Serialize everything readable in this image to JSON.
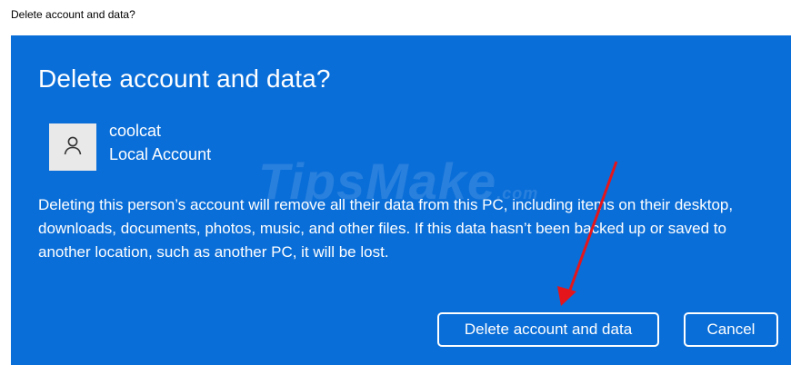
{
  "window": {
    "title": "Delete account and data?"
  },
  "dialog": {
    "title": "Delete account and data?",
    "account": {
      "name": "coolcat",
      "type": "Local Account",
      "avatar_icon": "person-icon"
    },
    "message": "Deleting this person’s account will remove all their data from this PC, including items on their desktop, downloads, documents, photos, music, and other files. If this data hasn’t been backed up or saved to another location, such as another PC, it will be lost.",
    "buttons": {
      "primary_label": "Delete account and data",
      "secondary_label": "Cancel"
    }
  },
  "watermark": {
    "text": "TipsMake",
    "suffix": ".com"
  },
  "annotation": {
    "arrow_color": "#e4161b"
  },
  "colors": {
    "dialog_background": "#0a6ed8",
    "text": "#ffffff",
    "avatar_background": "#e9e9e9"
  }
}
